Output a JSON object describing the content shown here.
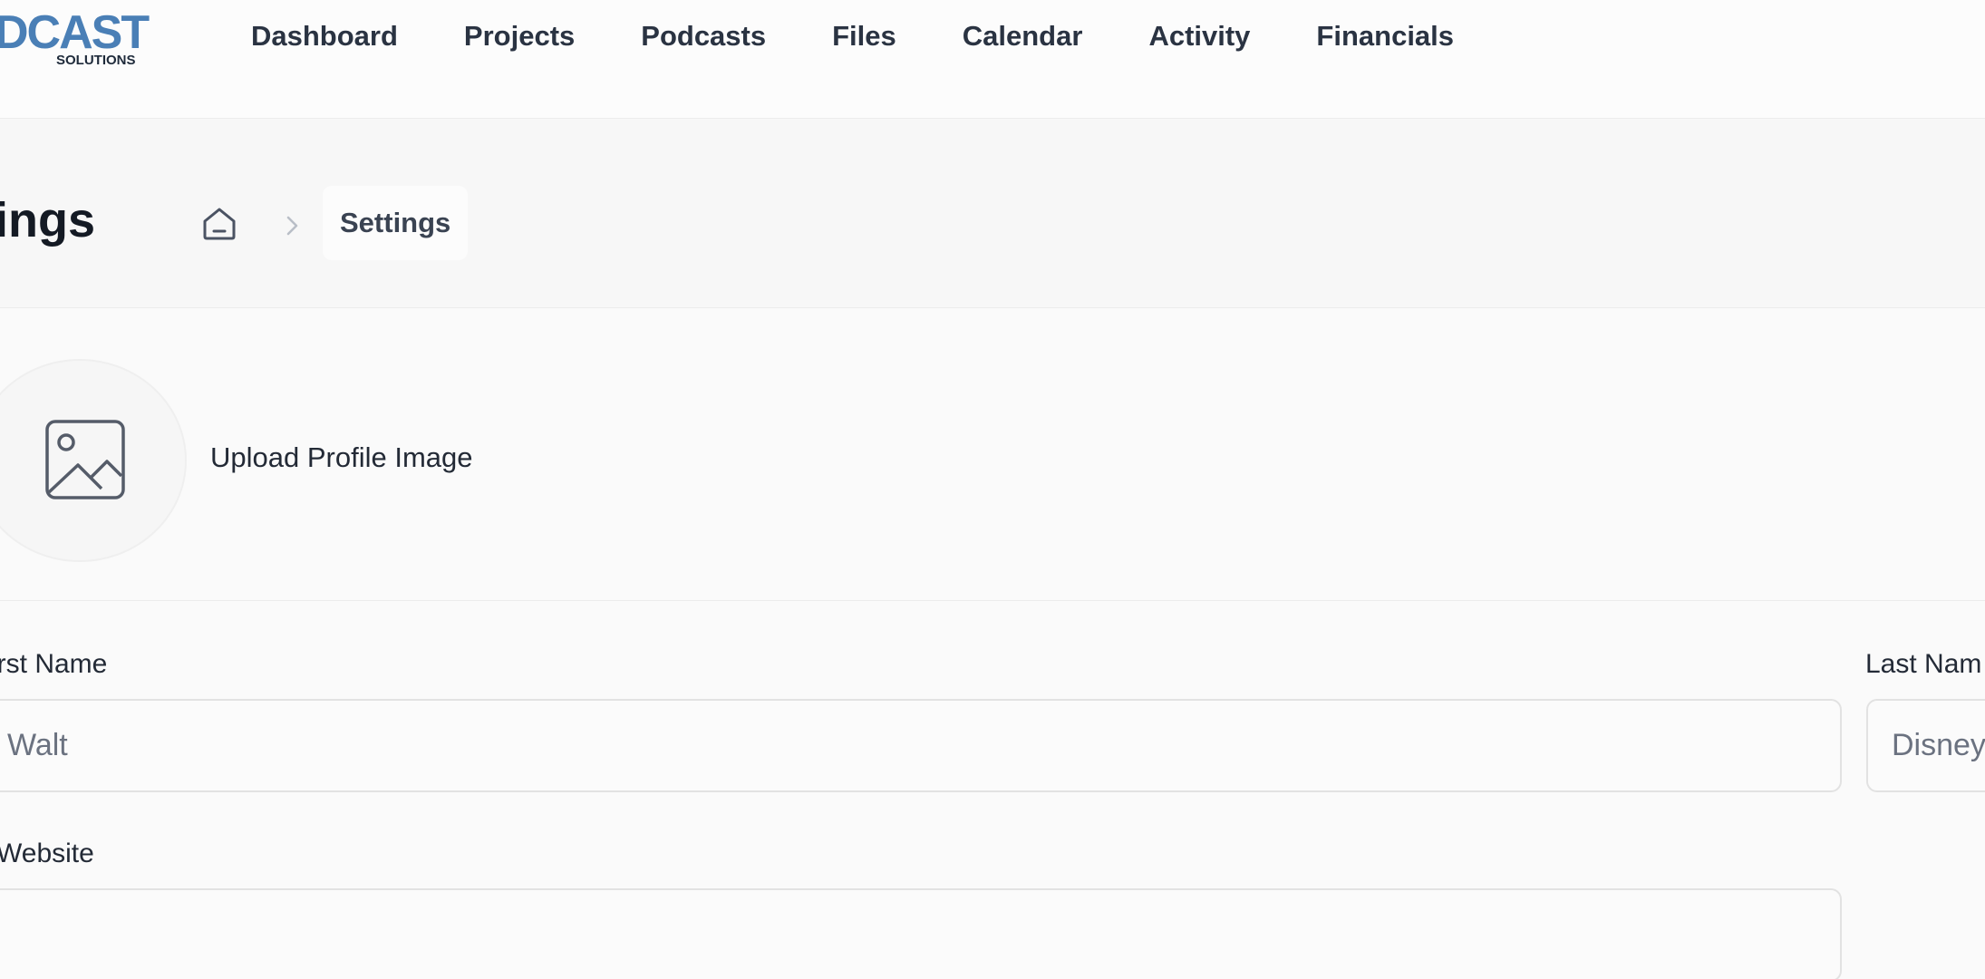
{
  "app": {
    "logo_text": "DCAST",
    "logo_subtext": "SOLUTIONS"
  },
  "nav": {
    "items": [
      {
        "label": "Dashboard"
      },
      {
        "label": "Projects"
      },
      {
        "label": "Podcasts"
      },
      {
        "label": "Files"
      },
      {
        "label": "Calendar"
      },
      {
        "label": "Activity"
      },
      {
        "label": "Financials"
      }
    ]
  },
  "header": {
    "title": "ttings",
    "breadcrumb": {
      "home_icon": "home-icon",
      "separator_icon": "chevron-right-icon",
      "current": "Settings"
    }
  },
  "profile": {
    "image_icon": "image-icon",
    "upload_label": "Upload Profile Image"
  },
  "form": {
    "first_name": {
      "label": "irst Name",
      "value": "Walt"
    },
    "last_name": {
      "label": "Last Nam",
      "value": "Disney"
    },
    "website": {
      "label": "Website",
      "value": ""
    }
  },
  "colors": {
    "logo_blue": "#4a7fb6",
    "nav_text": "#2a3342",
    "title_text": "#141a24",
    "input_border": "#e2e2e2"
  }
}
